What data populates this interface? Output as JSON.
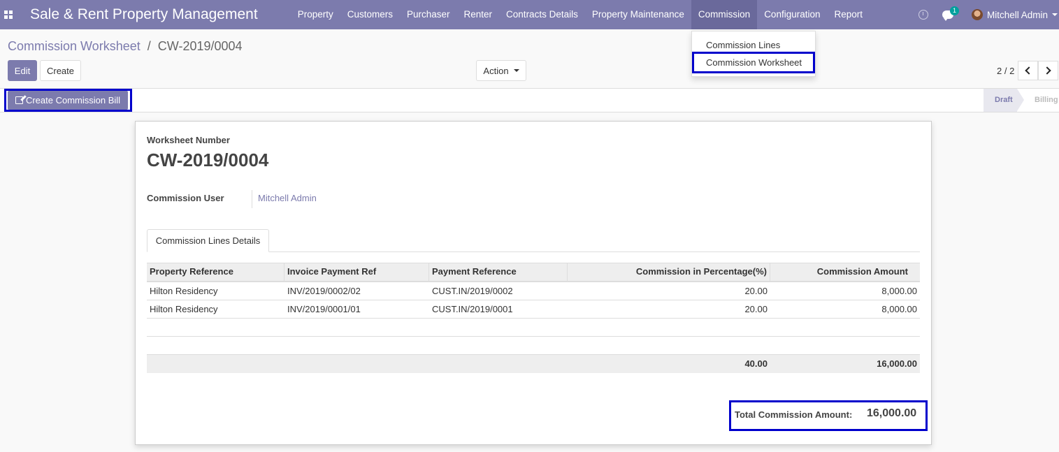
{
  "navbar": {
    "brand": "Sale & Rent Property Management",
    "menu": [
      "Property",
      "Customers",
      "Purchaser",
      "Renter",
      "Contracts Details",
      "Property Maintenance",
      "Commission",
      "Configuration",
      "Report"
    ],
    "active_menu": "Commission",
    "chat_badge": "1",
    "user_name": "Mitchell Admin",
    "bg_color": "#7c7bad"
  },
  "dropdown": {
    "items": [
      "Commission Lines",
      "Commission Worksheet"
    ]
  },
  "breadcrumb": {
    "parent": "Commission Worksheet",
    "separator": "/",
    "current": "CW-2019/0004"
  },
  "buttons": {
    "edit": "Edit",
    "create": "Create",
    "action": "Action",
    "create_bill": "Create Commission Bill"
  },
  "pager": {
    "text": "2 / 2"
  },
  "status": {
    "stages": [
      "Draft",
      "Billing"
    ],
    "active": "Draft"
  },
  "sheet": {
    "worksheet_label": "Worksheet Number",
    "worksheet_number": "CW-2019/0004",
    "user_label": "Commission User",
    "user_value": "Mitchell Admin",
    "tab": "Commission Lines Details",
    "table": {
      "headers": [
        "Property Reference",
        "Invoice Payment Ref",
        "Payment Reference",
        "Commission in Percentage(%)",
        "Commission Amount"
      ],
      "rows": [
        [
          "Hilton Residency",
          "INV/2019/0002/02",
          "CUST.IN/2019/0002",
          "20.00",
          "8,000.00"
        ],
        [
          "Hilton Residency",
          "INV/2019/0001/01",
          "CUST.IN/2019/0001",
          "20.00",
          "8,000.00"
        ]
      ],
      "footer": {
        "percentage_total": "40.00",
        "amount_total": "16,000.00"
      }
    },
    "total_label": "Total Commission Amount:",
    "total_value": "16,000.00"
  },
  "highlight_color": "#0000cc"
}
